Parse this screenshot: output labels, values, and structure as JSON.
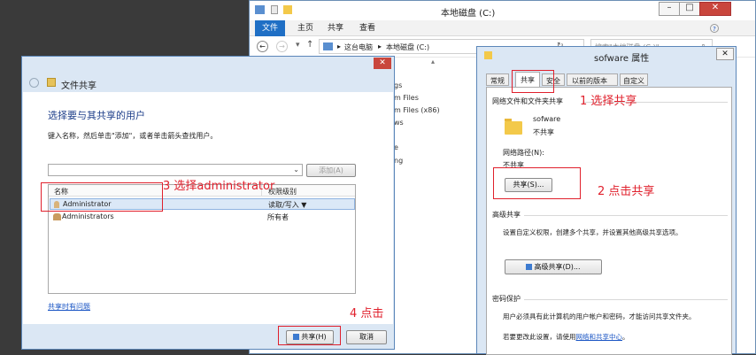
{
  "explorer": {
    "title": "本地磁盘 (C:)",
    "tabs": [
      "文件",
      "主页",
      "共享",
      "查看"
    ],
    "breadcrumb": [
      "这台电脑",
      "本地磁盘 (C:)"
    ],
    "search_placeholder": "搜索\"本地磁盘 (C:)\"",
    "files": [
      "gs",
      "m Files",
      "m Files (x86)",
      "ws",
      "e",
      "ng"
    ]
  },
  "share_dialog": {
    "title": "文件共享",
    "heading": "选择要与其共享的用户",
    "instruction": "键入名称，然后单击\"添加\"，或者单击箭头查找用户。",
    "add_button": "添加(A)",
    "columns": [
      "名称",
      "权限级别"
    ],
    "rows": [
      {
        "name": "Administrator",
        "permission": "读取/写入 ▼"
      },
      {
        "name": "Administrators",
        "permission": "所有者"
      }
    ],
    "help_link": "共享时有问题",
    "share_button": "共享(H)",
    "cancel_button": "取消"
  },
  "props_dialog": {
    "title": "sofware 属性",
    "tabs": [
      "常规",
      "共享",
      "安全",
      "以前的版本",
      "自定义"
    ],
    "net_group": "网络文件和文件夹共享",
    "folder_name": "sofware",
    "folder_state": "不共享",
    "net_path_label": "网络路径(N):",
    "net_path_value": "不共享",
    "share_button": "共享(S)...",
    "adv_group": "高级共享",
    "adv_desc": "设置自定义权限，创建多个共享，并设置其他高级共享选项。",
    "adv_button": "高级共享(D)...",
    "pw_group": "密码保护",
    "pw_desc": "用户必须具有此计算机的用户帐户和密码，才能访问共享文件夹。",
    "pw_change_prefix": "若要更改此设置，请使用",
    "pw_change_link": "网络和共享中心",
    "pw_change_suffix": "。"
  },
  "annotations": {
    "a1": "1 选择共享",
    "a2": "2 点击共享",
    "a3": "3 选择administrator",
    "a4": "4 点击"
  },
  "colors": {
    "annotation": "#e0202c",
    "accent": "#1a55c4",
    "ribbon_file_tab": "#1f6fc5"
  }
}
